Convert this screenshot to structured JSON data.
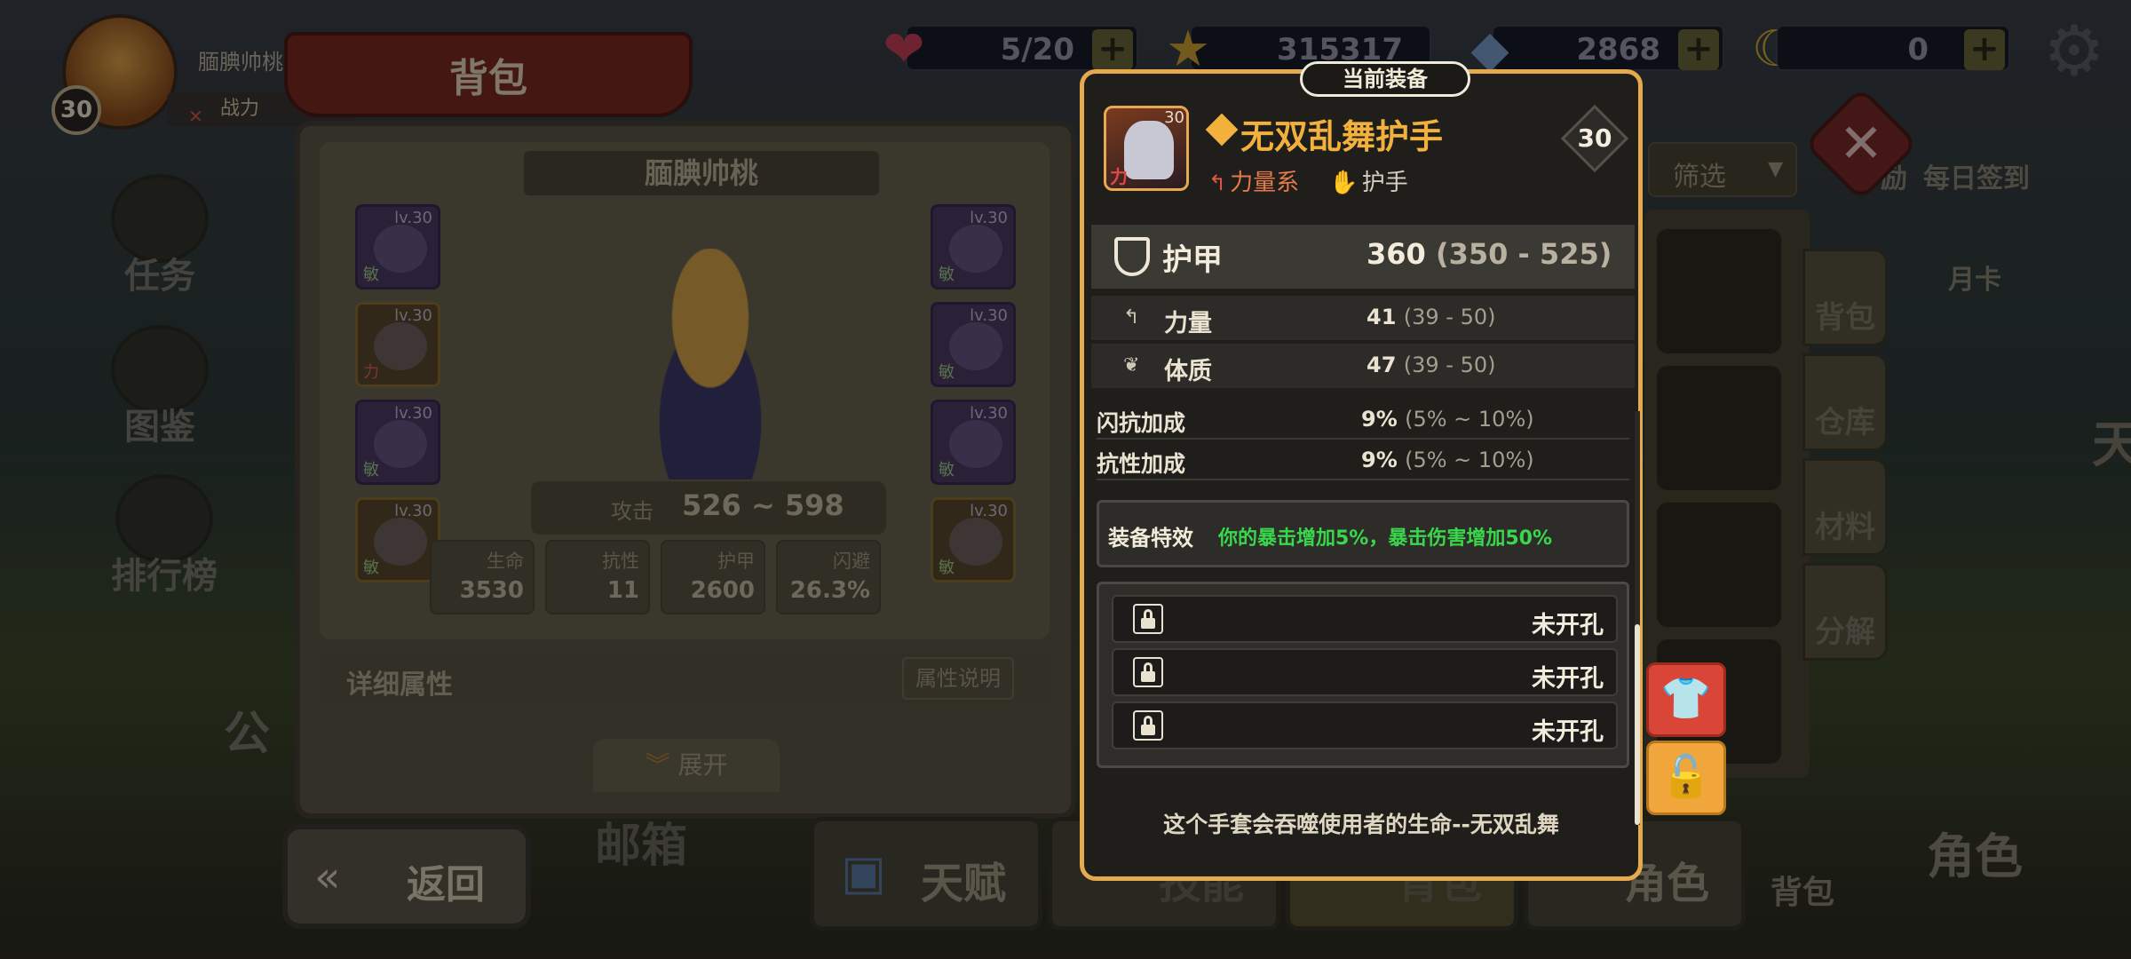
{
  "player": {
    "name": "腼腆帅桃",
    "level": "30",
    "power_label": "战力"
  },
  "resources": [
    {
      "icon": "heart-icon",
      "value": "5/20"
    },
    {
      "icon": "star-icon",
      "value": "315317"
    },
    {
      "icon": "gem-icon",
      "value": "2868"
    },
    {
      "icon": "moon-icon",
      "value": "0"
    }
  ],
  "backpack": {
    "title": "背包",
    "hero_name": "腼腆帅桃",
    "slots": [
      {
        "lv": "lv.30",
        "tag": "敏"
      },
      {
        "lv": "lv.30",
        "tag": "力"
      },
      {
        "lv": "lv.30",
        "tag": "敏"
      },
      {
        "lv": "lv.30",
        "tag": "敏"
      },
      {
        "lv": "lv.30",
        "tag": "敏"
      },
      {
        "lv": "lv.30",
        "tag": "敏"
      },
      {
        "lv": "lv.30",
        "tag": "敏"
      },
      {
        "lv": "lv.30",
        "tag": "敏"
      }
    ],
    "attack_label": "攻击",
    "attack_value": "526 ~ 598",
    "stats": [
      {
        "label": "生命",
        "value": "3530"
      },
      {
        "label": "抗性",
        "value": "11"
      },
      {
        "label": "护甲",
        "value": "2600"
      },
      {
        "label": "闪避",
        "value": "26.3%"
      }
    ],
    "detail_label": "详细属性",
    "detail_button": "属性说明",
    "expand_label": "展开"
  },
  "sidebar": [
    {
      "label": "任务"
    },
    {
      "label": "图鉴"
    },
    {
      "label": "排行榜"
    }
  ],
  "bottom": {
    "back": "返回",
    "mail": "邮箱",
    "partial_left": "公",
    "tabs": [
      {
        "label": "天赋"
      },
      {
        "label": "技能"
      },
      {
        "label": "背包"
      },
      {
        "label": "角色"
      }
    ],
    "bag_small": "背包",
    "role_big": "角色"
  },
  "right": {
    "filter": "筛选",
    "links": [
      "励",
      "每日签到",
      "月卡"
    ],
    "partial_edge": "天",
    "tabs": [
      {
        "label": "背包"
      },
      {
        "label": "仓库"
      },
      {
        "label": "材料"
      },
      {
        "label": "分解"
      }
    ]
  },
  "popup": {
    "title": "当前装备",
    "item_name": "无双乱舞护手",
    "item_icon_lv": "30",
    "item_icon_tag": "力",
    "level": "30",
    "category": "力量系",
    "type": "护手",
    "main_stat": {
      "label": "护甲",
      "value": "360",
      "range": "(350 - 525)"
    },
    "sub_stats": [
      {
        "label": "力量",
        "value": "41",
        "range": "(39 - 50)"
      },
      {
        "label": "体质",
        "value": "47",
        "range": "(39 - 50)"
      }
    ],
    "extra_stats": [
      {
        "label": "闪抗加成",
        "value": "9%",
        "range": "(5% ~ 10%)"
      },
      {
        "label": "抗性加成",
        "value": "9%",
        "range": "(5% ~ 10%)"
      }
    ],
    "special_label": "装备特效",
    "special_text": "你的暴击增加5%，暴击伤害增加50%",
    "sockets": [
      {
        "label": "未开孔"
      },
      {
        "label": "未开孔"
      },
      {
        "label": "未开孔"
      }
    ],
    "description": "这个手套会吞噬使用者的生命--无双乱舞"
  },
  "colors": {
    "accent_gold": "#e6a94e",
    "name_gold": "#f2b13d",
    "special_green": "#39d74c",
    "unequip_red": "#d94638",
    "unlock_gold": "#f0a63a"
  }
}
